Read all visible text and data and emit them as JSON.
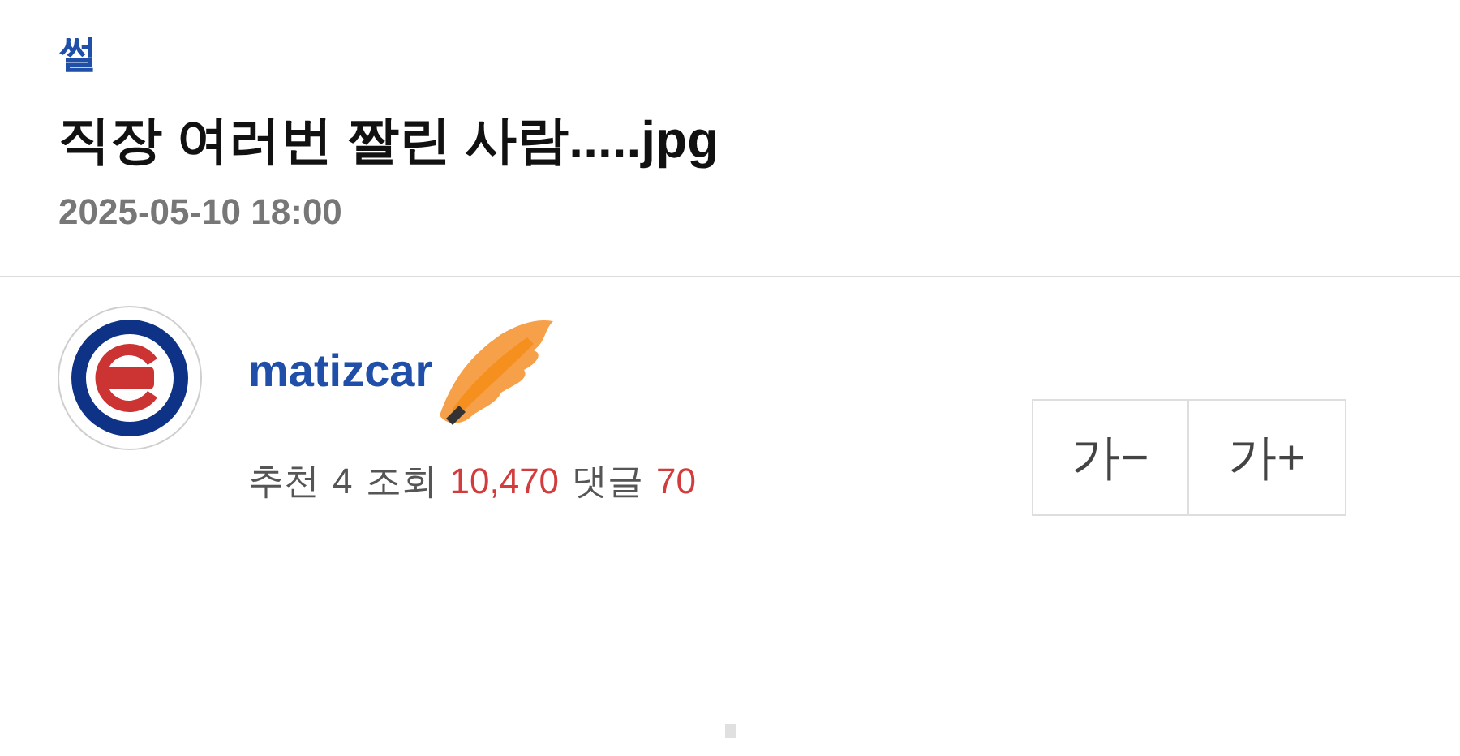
{
  "category": "썰",
  "title": "직장 여러번 짤린 사람.....jpg",
  "date": "2025-05-10 18:00",
  "author": {
    "name": "matizcar"
  },
  "stats": [
    {
      "label": "추천",
      "value": "4",
      "highlight": false
    },
    {
      "label": "조회",
      "value": "10,470",
      "highlight": true
    },
    {
      "label": "댓글",
      "value": "70",
      "highlight": true
    }
  ],
  "font_buttons": [
    "가−",
    "가+"
  ]
}
